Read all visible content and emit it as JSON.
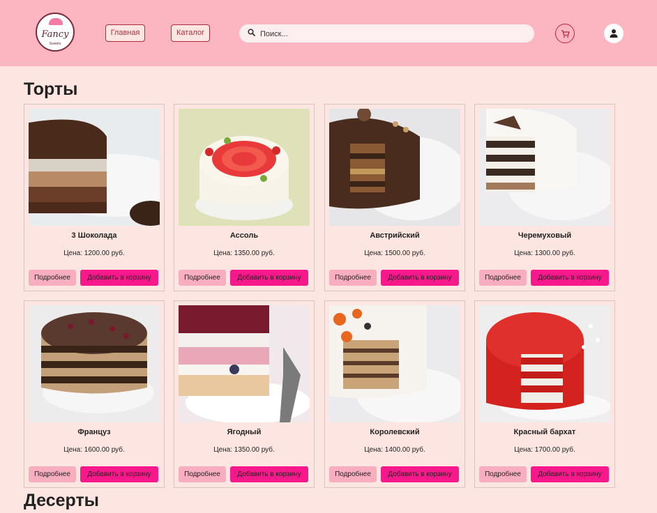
{
  "header": {
    "logo_script": "Fancy",
    "logo_sub": "Sweets",
    "nav": [
      "Главная",
      "Каталог"
    ],
    "search_placeholder": "Поиск...",
    "cart_icon": "cart-icon",
    "user_icon": "user-icon"
  },
  "colors": {
    "header_bg": "#fbb6c2",
    "page_bg": "#fde6e1",
    "accent": "#f7188b",
    "secondary_btn": "#f9aec0",
    "nav_border": "#b22a3c"
  },
  "sections": [
    {
      "title": "Торты",
      "products": [
        {
          "name": "3 Шоколада",
          "price": "Цена: 1200.00 руб.",
          "image": "three-chocolate-cake"
        },
        {
          "name": "Ассоль",
          "price": "Цена: 1350.00 руб.",
          "image": "assol-cake"
        },
        {
          "name": "Австрийский",
          "price": "Цена: 1500.00 руб.",
          "image": "austrian-cake"
        },
        {
          "name": "Черемуховый",
          "price": "Цена: 1300.00 руб.",
          "image": "bird-cherry-cake"
        },
        {
          "name": "Францyз",
          "price": "Цена: 1600.00 руб.",
          "image": "frantsuz-cake"
        },
        {
          "name": "Ягодный",
          "price": "Цена: 1350.00 руб.",
          "image": "berry-cake"
        },
        {
          "name": "Королевский",
          "price": "Цена: 1400.00 руб.",
          "image": "royal-cake"
        },
        {
          "name": "Красный бархат",
          "price": "Цена: 1700.00 руб.",
          "image": "red-velvet-cake"
        }
      ]
    },
    {
      "title": "Десерты",
      "products": []
    }
  ],
  "buttons": {
    "details": "Подробнее",
    "add_to_cart": "Добавить в корзину"
  }
}
